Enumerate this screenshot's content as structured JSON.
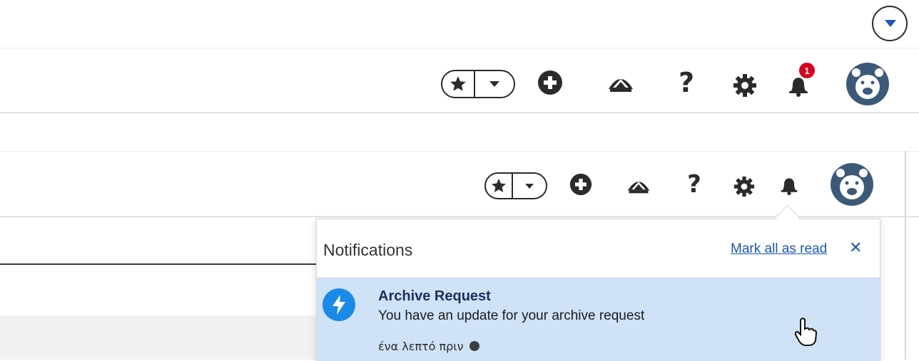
{
  "header_top": {
    "favorites_icon": "star-icon",
    "add_icon": "plus-circle-icon",
    "trailhead_icon": "trailhead-icon",
    "help_label": "?",
    "setup_icon": "gear-icon",
    "bell_icon": "bell-icon",
    "notification_count": "1",
    "avatar_icon": "bear-avatar-icon"
  },
  "header_bottom": {
    "help_label": "?",
    "bell_icon": "bell-icon",
    "avatar_icon": "bear-avatar-icon"
  },
  "notifications_panel": {
    "title": "Notifications",
    "mark_all_label": "Mark all as read",
    "close_label": "✕",
    "items": [
      {
        "icon": "lightning-icon",
        "title": "Archive Request",
        "body": "You have an update for your archive request",
        "time": "ένα λεπτό πριν",
        "unread": true
      }
    ]
  },
  "colors": {
    "link": "#1a57b8",
    "highlight": "#cfe2f7",
    "badge": "#d9001b",
    "avatar": "#3b5a7a",
    "notification_icon_bg": "#1a8ae8"
  }
}
